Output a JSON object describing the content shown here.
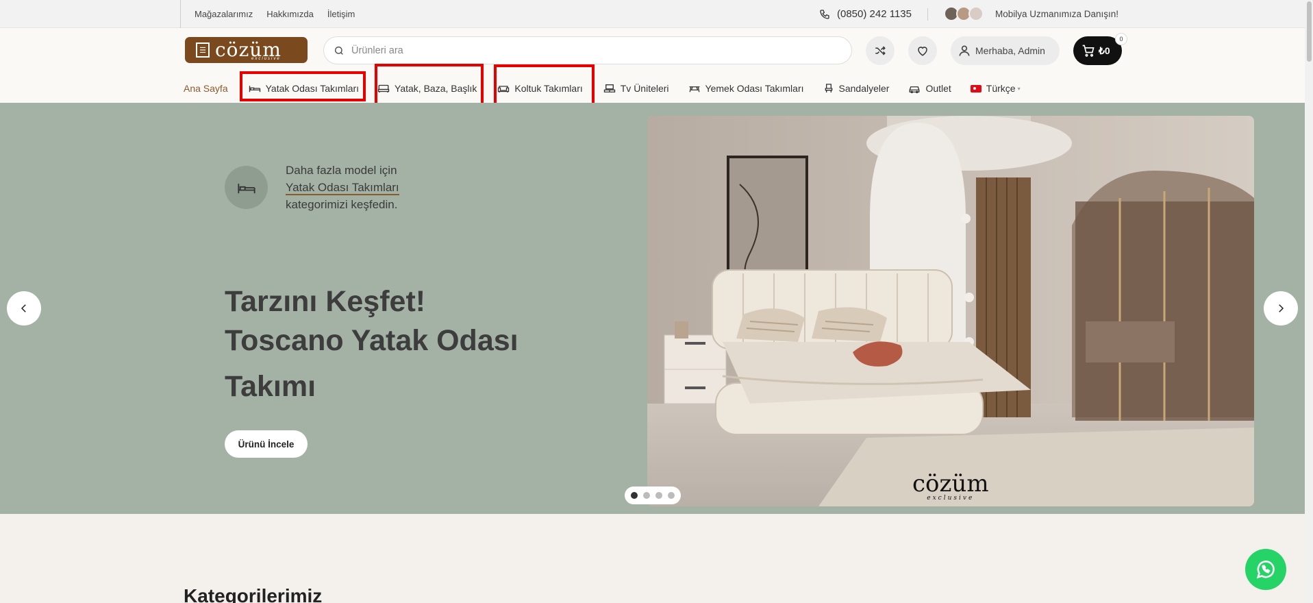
{
  "topbar": {
    "links": [
      "Mağazalarımız",
      "Hakkımızda",
      "İletişim"
    ],
    "phone": "(0850) 242 1135",
    "expert_text": "Mobilya Uzmanımıza Danışın!"
  },
  "header": {
    "logo_name": "cözüm",
    "logo_sub": "exclusive",
    "search_placeholder": "Ürünleri ara",
    "account_label": "Merhaba, Admin",
    "cart_total": "₺0",
    "cart_count": "0"
  },
  "nav": {
    "home": "Ana Sayfa",
    "items": [
      {
        "label": "Yatak Odası Takımları",
        "icon": "bed-icon"
      },
      {
        "label": "Yatak, Baza, Başlık",
        "icon": "bed-icon"
      },
      {
        "label": "Koltuk Takımları",
        "icon": "sofa-icon"
      },
      {
        "label": "Tv Üniteleri",
        "icon": "tv-unit-icon"
      },
      {
        "label": "Yemek Odası Takımları",
        "icon": "dining-table-icon"
      },
      {
        "label": "Sandalyeler",
        "icon": "chair-icon"
      },
      {
        "label": "Outlet",
        "icon": "car-icon"
      }
    ],
    "language": "Türkçe"
  },
  "hero": {
    "cat_line1": "Daha fazla model için",
    "cat_link": "Yatak Odası Takımları",
    "cat_line3": "kategorimizi keşfedin.",
    "title_line1": "Tarzını Keşfet!",
    "title_line2": "Toscano Yatak Odası",
    "title_line3": "Takımı",
    "cta": "Ürünü İncele",
    "slides": 4,
    "active_slide": 1
  },
  "section": {
    "heading": "Kategorilerimiz"
  },
  "colors": {
    "brand_brown": "#7a4a1e",
    "hero_bg": "#a4b2a5",
    "highlight_red": "#e60000",
    "whatsapp_green": "#25d366"
  }
}
